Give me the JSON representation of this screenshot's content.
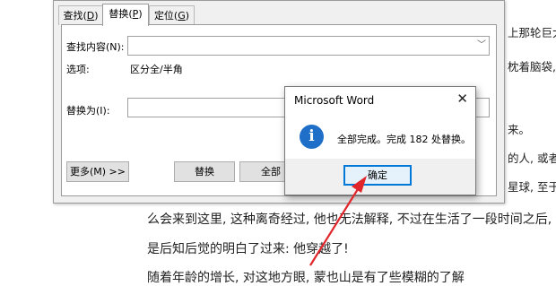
{
  "document": {
    "right_fragments": [
      {
        "text": "上那轮巨大的"
      },
      {
        "text": "枕着脑袋,"
      },
      {
        "text": "来。"
      },
      {
        "text": "的人, 或者"
      },
      {
        "text": "星球, 至于"
      }
    ],
    "lines": [
      "么会来到这里, 这种离奇经过, 他也无法解释, 不过在生活了一段时间之后, 他",
      "是后知后觉的明白了过来: 他穿越了!",
      "随着年龄的增长, 对这地方眼, 蒙也山是有了些模糊的了解"
    ]
  },
  "find_replace": {
    "tabs": [
      {
        "label": "查找(",
        "key": "D",
        "suffix": ")"
      },
      {
        "label": "替换(",
        "key": "P",
        "suffix": ")"
      },
      {
        "label": "定位(",
        "key": "G",
        "suffix": ")"
      }
    ],
    "find_label": "查找内容(N):",
    "find_value": "",
    "options_label": "选项:",
    "options_value": "区分全/半角",
    "replace_label": "替换为(I):",
    "replace_value": "",
    "more_button": "更多(M) >>",
    "replace_button": "替换",
    "replace_all_button": "全部"
  },
  "message_box": {
    "title": "Microsoft Word",
    "close_glyph": "✕",
    "icon_glyph": "i",
    "message": "全部完成。完成 182 处替换。",
    "ok_button": "确定"
  },
  "colors": {
    "arrow": "#e0262b",
    "accent": "#0078d7",
    "info_icon": "#1f6fc9"
  }
}
